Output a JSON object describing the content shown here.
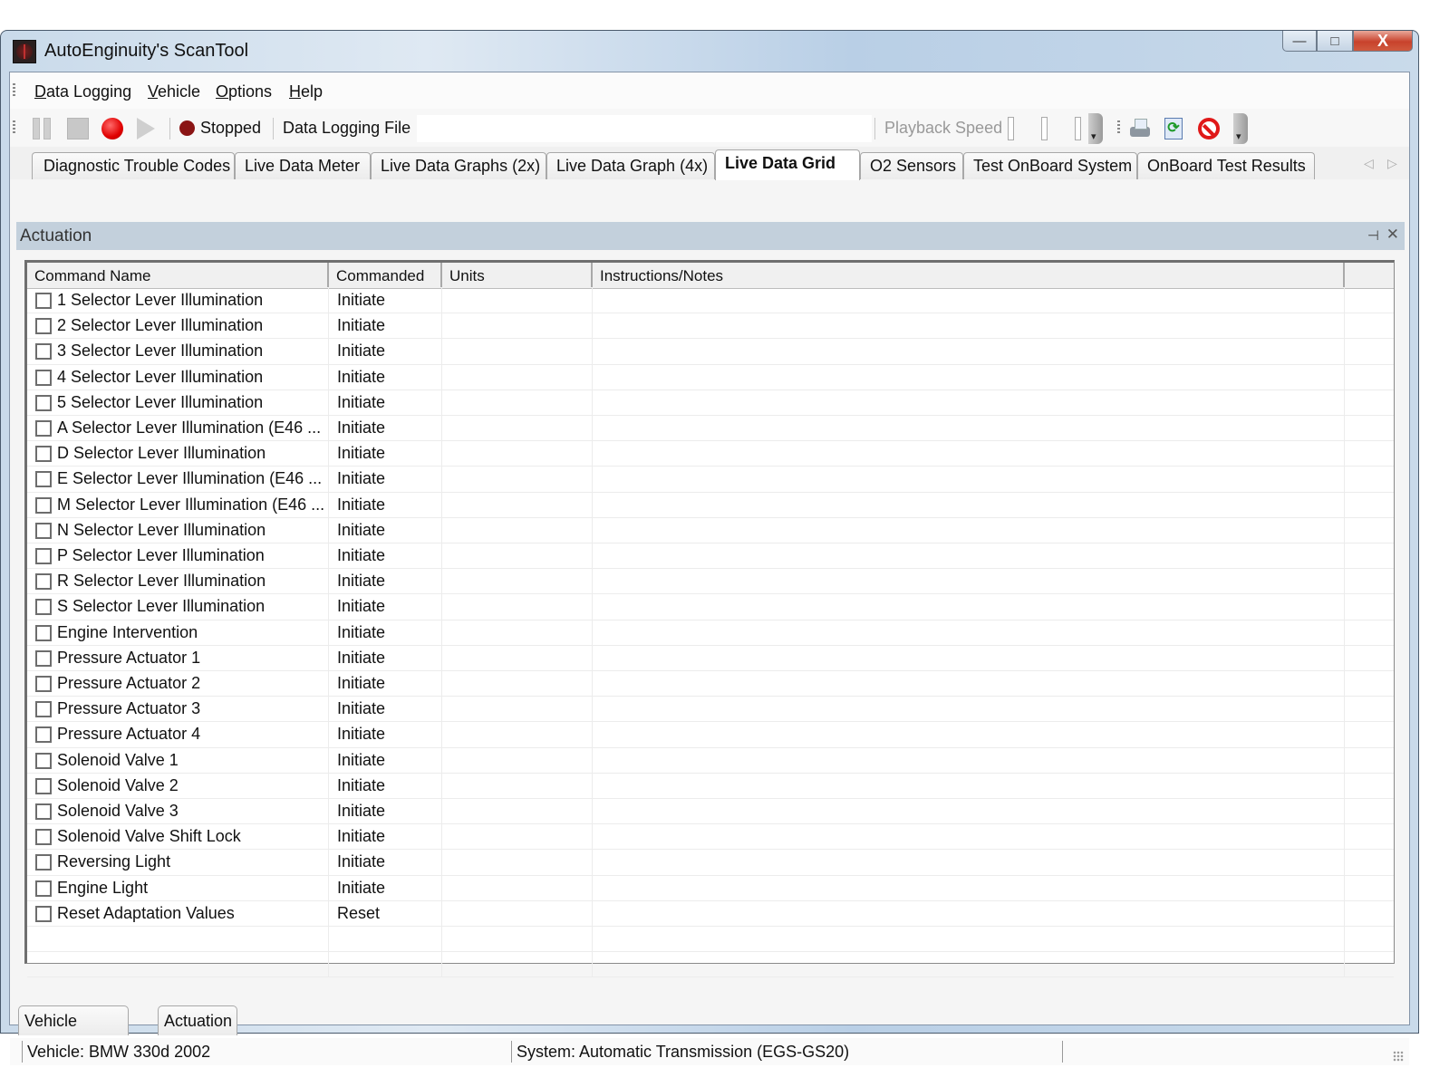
{
  "window": {
    "title": "AutoEnginuity's ScanTool",
    "controls": {
      "minimize": "—",
      "maximize": "□",
      "close": "X"
    }
  },
  "menu": [
    {
      "label": "Data Logging",
      "accel": "D"
    },
    {
      "label": "Vehicle",
      "accel": "V"
    },
    {
      "label": "Options",
      "accel": "O"
    },
    {
      "label": "Help",
      "accel": "H"
    }
  ],
  "toolbar": {
    "status_label": "Stopped",
    "data_logging_label": "Data Logging File",
    "data_logging_value": "",
    "playback_label": "Playback Speed",
    "icons": [
      "pause-icon",
      "stop-icon",
      "record-icon",
      "play-icon",
      "print-icon",
      "refresh-icon",
      "cancel-icon"
    ],
    "status_color": "#8a1414",
    "record_color": "#e00000"
  },
  "tabs": [
    {
      "label": "Diagnostic Trouble Codes",
      "active": false
    },
    {
      "label": "Live Data Meter",
      "active": false
    },
    {
      "label": "Live Data Graphs (2x)",
      "active": false
    },
    {
      "label": "Live Data Graph (4x)",
      "active": false
    },
    {
      "label": "Live Data Grid",
      "active": true
    },
    {
      "label": "O2 Sensors",
      "active": false
    },
    {
      "label": "Test OnBoard System",
      "active": false
    },
    {
      "label": "OnBoard Test Results",
      "active": false
    }
  ],
  "panel": {
    "title": "Actuation",
    "pin_glyph": "⊣",
    "close_glyph": "✕"
  },
  "grid": {
    "columns": [
      "Command Name",
      "Commanded",
      "Units",
      "Instructions/Notes"
    ],
    "rows": [
      {
        "name": "1 Selector Lever Illumination",
        "commanded": "Initiate",
        "units": "",
        "notes": "",
        "checked": false
      },
      {
        "name": "2 Selector Lever Illumination",
        "commanded": "Initiate",
        "units": "",
        "notes": "",
        "checked": false
      },
      {
        "name": "3 Selector Lever Illumination",
        "commanded": "Initiate",
        "units": "",
        "notes": "",
        "checked": false
      },
      {
        "name": "4 Selector Lever Illumination",
        "commanded": "Initiate",
        "units": "",
        "notes": "",
        "checked": false
      },
      {
        "name": "5 Selector Lever Illumination",
        "commanded": "Initiate",
        "units": "",
        "notes": "",
        "checked": false
      },
      {
        "name": "A Selector Lever Illumination (E46 ...",
        "commanded": "Initiate",
        "units": "",
        "notes": "",
        "checked": false
      },
      {
        "name": "D Selector Lever Illumination",
        "commanded": "Initiate",
        "units": "",
        "notes": "",
        "checked": false
      },
      {
        "name": "E Selector Lever Illumination (E46 ...",
        "commanded": "Initiate",
        "units": "",
        "notes": "",
        "checked": false
      },
      {
        "name": "M Selector Lever Illumination (E46 ...",
        "commanded": "Initiate",
        "units": "",
        "notes": "",
        "checked": false
      },
      {
        "name": "N Selector Lever Illumination",
        "commanded": "Initiate",
        "units": "",
        "notes": "",
        "checked": false
      },
      {
        "name": "P Selector Lever Illumination",
        "commanded": "Initiate",
        "units": "",
        "notes": "",
        "checked": false
      },
      {
        "name": "R Selector Lever Illumination",
        "commanded": "Initiate",
        "units": "",
        "notes": "",
        "checked": false
      },
      {
        "name": "S Selector Lever Illumination",
        "commanded": "Initiate",
        "units": "",
        "notes": "",
        "checked": false
      },
      {
        "name": "Engine Intervention",
        "commanded": "Initiate",
        "units": "",
        "notes": "",
        "checked": false
      },
      {
        "name": "Pressure Actuator 1",
        "commanded": "Initiate",
        "units": "",
        "notes": "",
        "checked": false
      },
      {
        "name": "Pressure Actuator 2",
        "commanded": "Initiate",
        "units": "",
        "notes": "",
        "checked": false
      },
      {
        "name": "Pressure Actuator 3",
        "commanded": "Initiate",
        "units": "",
        "notes": "",
        "checked": false
      },
      {
        "name": "Pressure Actuator 4",
        "commanded": "Initiate",
        "units": "",
        "notes": "",
        "checked": false
      },
      {
        "name": "Solenoid Valve 1",
        "commanded": "Initiate",
        "units": "",
        "notes": "",
        "checked": false
      },
      {
        "name": "Solenoid Valve 2",
        "commanded": "Initiate",
        "units": "",
        "notes": "",
        "checked": false
      },
      {
        "name": "Solenoid Valve 3",
        "commanded": "Initiate",
        "units": "",
        "notes": "",
        "checked": false
      },
      {
        "name": "Solenoid Valve Shift Lock",
        "commanded": "Initiate",
        "units": "",
        "notes": "",
        "checked": false
      },
      {
        "name": "Reversing Light",
        "commanded": "Initiate",
        "units": "",
        "notes": "",
        "checked": false
      },
      {
        "name": "Engine Light",
        "commanded": "Initiate",
        "units": "",
        "notes": "",
        "checked": false
      },
      {
        "name": "Reset Adaptation Values",
        "commanded": "Reset",
        "units": "",
        "notes": "",
        "checked": false
      }
    ]
  },
  "bottom_tabs": [
    {
      "label": "Vehicle Notes"
    },
    {
      "label": "Actuation"
    }
  ],
  "statusbar": {
    "vehicle": "Vehicle: BMW  330d  2002",
    "system": "System: Automatic Transmission (EGS-GS20)",
    "extra": ""
  }
}
